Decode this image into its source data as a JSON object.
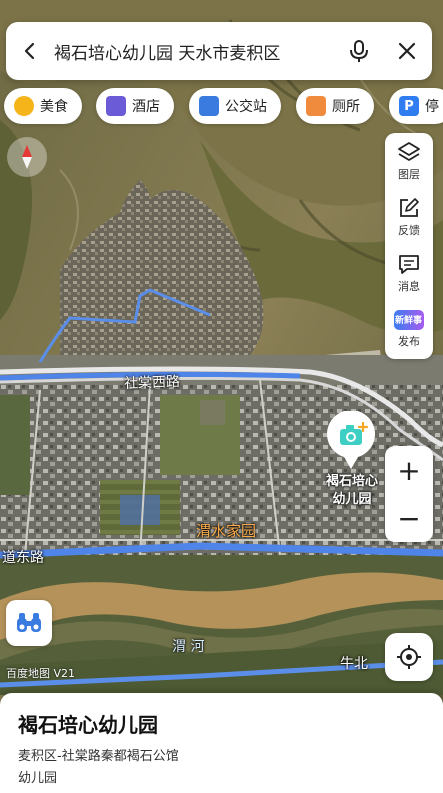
{
  "search": {
    "query": "褐石培心幼儿园 天水市麦积区",
    "back_icon": "back-arrow-icon",
    "mic_icon": "microphone-icon",
    "close_icon": "close-icon"
  },
  "chips": [
    {
      "label": "美食",
      "icon": "food-icon",
      "color": "#f5b41a"
    },
    {
      "label": "酒店",
      "icon": "hotel-icon",
      "color": "#6b5bd6"
    },
    {
      "label": "公交站",
      "icon": "bus-stop-icon",
      "color": "#3a7be0"
    },
    {
      "label": "厕所",
      "icon": "toilet-icon",
      "color": "#f08a3c"
    },
    {
      "label": "停",
      "icon": "parking-icon",
      "color": "#2f7df0"
    }
  ],
  "toolbar": {
    "layers": "图层",
    "feedback": "反馈",
    "messages": "消息",
    "publish": "发布",
    "publish_badge": "新鲜事"
  },
  "zoom": {
    "in": "+",
    "out": "−"
  },
  "map_labels": {
    "road_top": "社棠西路",
    "road_left": "道东路",
    "road_bottom": "牛北",
    "residential": "渭水家园",
    "river": "渭 河",
    "attribution": "百度地图 V21"
  },
  "poi": {
    "label_line1": "褐石培心",
    "label_line2": "幼儿园",
    "icon": "camera-plus-icon",
    "accent": "#3ecfc4"
  },
  "sheet": {
    "title": "褐石培心幼儿园",
    "address": "麦积区-社棠路秦都褐石公馆",
    "category": "幼儿园"
  },
  "colors": {
    "route_blue": "#4f84e8",
    "road_white": "#f2f2f2"
  }
}
